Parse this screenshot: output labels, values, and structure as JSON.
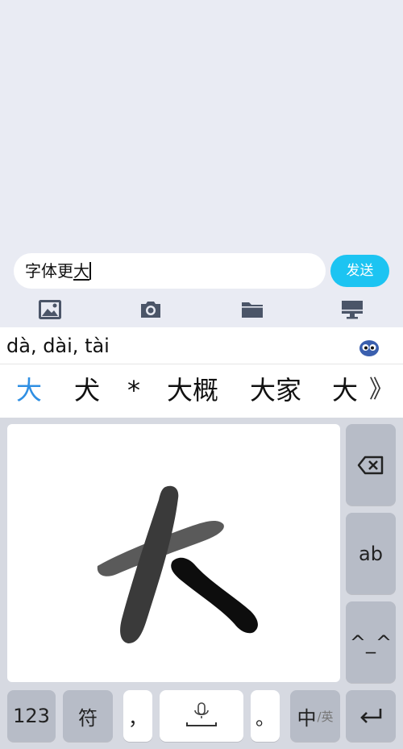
{
  "composer": {
    "text_committed": "字体更",
    "text_composing": "大",
    "send_label": "发送"
  },
  "toolbar": {
    "icons": [
      "image-icon",
      "camera-icon",
      "folder-icon",
      "monitor-icon"
    ]
  },
  "ime": {
    "pinyin": "dà, dài, tài",
    "candidates": [
      "大",
      "犬",
      "*",
      "大概",
      "大家",
      "大"
    ],
    "more_symbol": "》",
    "side_keys": {
      "delete_icon": "backspace-icon",
      "ab_label": "ab",
      "emoticon_label": "^_^"
    },
    "bottom_keys": {
      "num_label": "123",
      "symbol_label": "符",
      "comma_label": "，",
      "period_label": "。",
      "lang_main": "中",
      "lang_sub": "/英",
      "enter_icon": "enter-icon"
    }
  },
  "colors": {
    "background": "#e9ebf3",
    "send_button": "#1cc4f2",
    "candidate_active": "#2f8fe3",
    "key_dark": "#b7bcc7",
    "keyboard_bg": "#d6d9e1"
  }
}
